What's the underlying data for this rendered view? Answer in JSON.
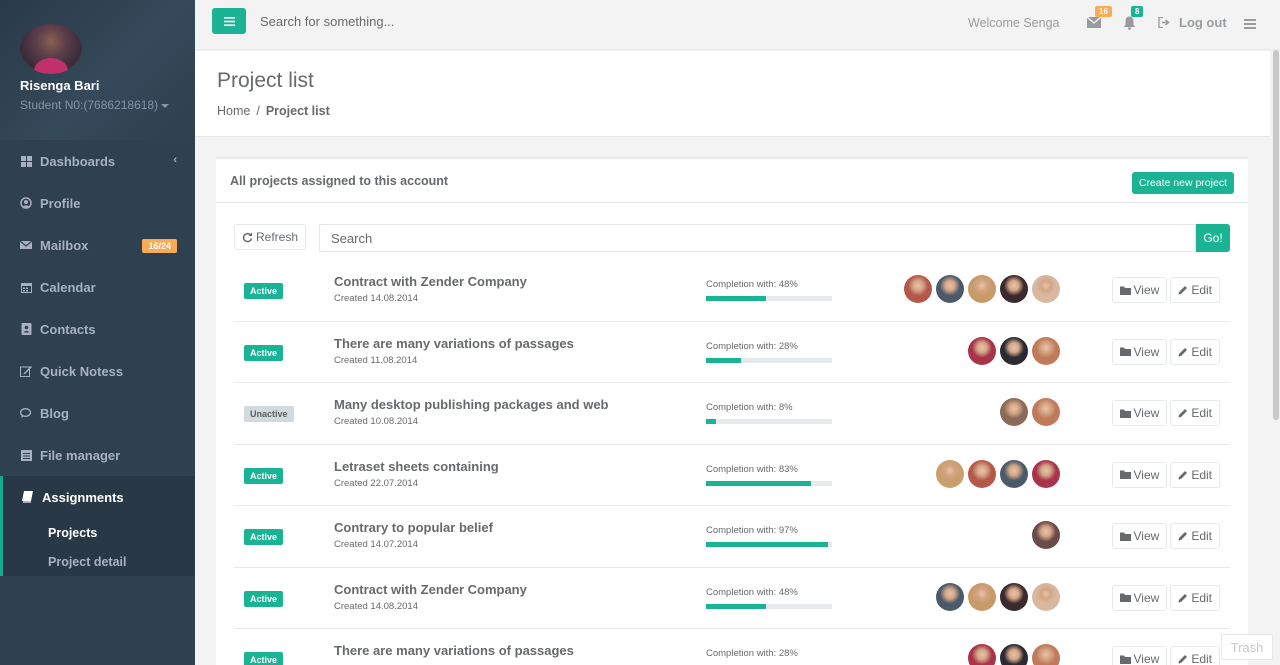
{
  "sidebar": {
    "profile": {
      "name": "Risenga Bari",
      "subtitle": "Student N0:(7686218618)"
    },
    "items": [
      {
        "label": "Dashboards",
        "icon": "th-large-icon"
      },
      {
        "label": "Profile",
        "icon": "user-icon"
      },
      {
        "label": "Mailbox",
        "icon": "envelope-icon",
        "badge": "16/24"
      },
      {
        "label": "Calendar",
        "icon": "calendar-icon"
      },
      {
        "label": "Contacts",
        "icon": "address-book-icon"
      },
      {
        "label": "Quick Notess",
        "icon": "edit-icon"
      },
      {
        "label": "Blog",
        "icon": "comments-icon"
      },
      {
        "label": "File manager",
        "icon": "files-icon"
      }
    ],
    "active": {
      "label": "Assignments",
      "icon": "book-icon",
      "subitems": [
        {
          "label": "Projects"
        },
        {
          "label": "Project detail"
        }
      ]
    }
  },
  "topbar": {
    "search_placeholder": "Search for something...",
    "welcome": "Welcome Senga",
    "messages_count": "16",
    "notifications_count": "8",
    "logout": "Log out"
  },
  "heading": {
    "title": "Project list",
    "breadcrumb": {
      "home": "Home",
      "sep": "/",
      "current": "Project list"
    }
  },
  "ibox": {
    "title": "All projects assigned to this account",
    "create_label": "Create new project",
    "refresh_label": "Refresh",
    "search_placeholder": "Search",
    "go_label": "Go!",
    "view_label": "View",
    "edit_label": "Edit",
    "projects": [
      {
        "status": "Active",
        "title": "Contract with Zender Company",
        "created": "Created 14.08.2014",
        "completion": "Completion with: 48%",
        "progress": 48,
        "members": [
          "#b5584a",
          "#4a5a6a",
          "#c89a6a",
          "#3a2a30",
          "#d9b8a0"
        ]
      },
      {
        "status": "Active",
        "title": "There are many variations of passages",
        "created": "Created 11.08.2014",
        "completion": "Completion with: 28%",
        "progress": 28,
        "members": [
          "#a8334a",
          "#2a2a35",
          "#c07a5a"
        ]
      },
      {
        "status": "Unactive",
        "title": "Many desktop publishing packages and web",
        "created": "Created 10.08.2014",
        "completion": "Completion with: 8%",
        "progress": 8,
        "members": [
          "#8a6a58",
          "#c07a5a"
        ]
      },
      {
        "status": "Active",
        "title": "Letraset sheets containing",
        "created": "Created 22.07.2014",
        "completion": "Completion with: 83%",
        "progress": 83,
        "members": [
          "#c8a070",
          "#b5584a",
          "#4a5a6a",
          "#a8334a"
        ]
      },
      {
        "status": "Active",
        "title": "Contrary to popular belief",
        "created": "Created 14.07.2014",
        "completion": "Completion with: 97%",
        "progress": 97,
        "members": [
          "#6a4a4a"
        ]
      },
      {
        "status": "Active",
        "title": "Contract with Zender Company",
        "created": "Created 14.08.2014",
        "completion": "Completion with: 48%",
        "progress": 48,
        "members": [
          "#4a5a6a",
          "#c89a6a",
          "#3a2a30",
          "#d9b8a0"
        ]
      },
      {
        "status": "Active",
        "title": "There are many variations of passages",
        "created": "",
        "completion": "Completion with: 28%",
        "progress": 28,
        "members": [
          "#a8334a",
          "#2a2a35",
          "#c07a5a"
        ]
      }
    ]
  },
  "overlay": {
    "trash_label": "Trash"
  }
}
